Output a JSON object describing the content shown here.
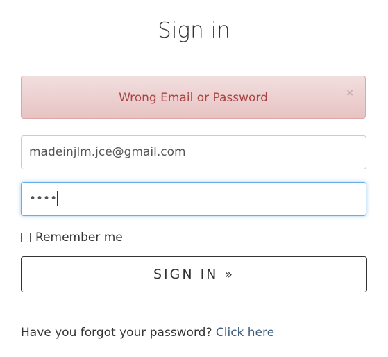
{
  "title": "Sign in",
  "alert": {
    "message": "Wrong Email or Password",
    "close": "×"
  },
  "email": {
    "value": "madeinjlm.jce@gmail.com"
  },
  "password": {
    "masked": "••••"
  },
  "remember": {
    "label": "Remember me"
  },
  "submit": {
    "label": "SIGN IN »"
  },
  "forgot": {
    "text": "Have you forgot your password?",
    "link": "Click here"
  }
}
